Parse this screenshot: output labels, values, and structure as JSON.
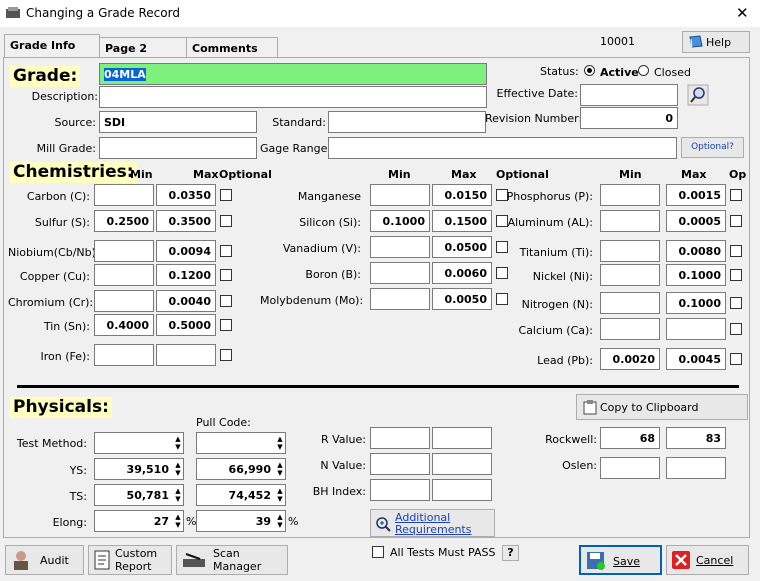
{
  "window": {
    "title": "Changing a Grade Record",
    "record_id": "10001"
  },
  "tabs": [
    {
      "label": "Grade Info"
    },
    {
      "label": "Page 2"
    },
    {
      "label": "Comments"
    }
  ],
  "help_button": "Help",
  "grade": {
    "header": "Grade:",
    "grade_value": "04MLA",
    "description_label": "Description:",
    "description_value": "",
    "source_label": "Source:",
    "source_value": "SDI",
    "standard_label": "Standard:",
    "standard_value": "",
    "mill_grade_label": "Mill Grade:",
    "mill_grade_value": "",
    "gage_range_label": "Gage Range:",
    "gage_range_value": "",
    "optional_button": "Optional?",
    "status_label": "Status:",
    "status_active": "Active",
    "status_closed": "Closed",
    "effective_date_label": "Effective Date:",
    "effective_date_value": "",
    "revision_label": "Revision Number:",
    "revision_value": "0"
  },
  "chem": {
    "header": "Chemistries:",
    "col_min": "Min",
    "col_max": "Max",
    "col_optional": "Optional",
    "col_op": "Op",
    "col1": [
      {
        "label": "Carbon (C):",
        "min": "",
        "max": "0.0350"
      },
      {
        "label": "Sulfur (S):",
        "min": "0.2500",
        "max": "0.3500"
      },
      {
        "label": "Niobium(Cb/Nb)",
        "min": "",
        "max": "0.0094"
      },
      {
        "label": "Copper (Cu):",
        "min": "",
        "max": "0.1200"
      },
      {
        "label": "Chromium (Cr):",
        "min": "",
        "max": "0.0040"
      },
      {
        "label": "Tin (Sn):",
        "min": "0.4000",
        "max": "0.5000"
      },
      {
        "label": "Iron (Fe):",
        "min": "",
        "max": ""
      }
    ],
    "col2": [
      {
        "label": "Manganese",
        "min": "",
        "max": "0.0150"
      },
      {
        "label": "Silicon (Si):",
        "min": "0.1000",
        "max": "0.1500"
      },
      {
        "label": "Vanadium (V):",
        "min": "",
        "max": "0.0500"
      },
      {
        "label": "Boron (B):",
        "min": "",
        "max": "0.0060"
      },
      {
        "label": "Molybdenum (Mo):",
        "min": "",
        "max": "0.0050"
      }
    ],
    "col3": [
      {
        "label": "Phosphorus (P):",
        "min": "",
        "max": "0.0015"
      },
      {
        "label": "Aluminum (AL):",
        "min": "",
        "max": "0.0005"
      },
      {
        "label": "Titanium (Ti):",
        "min": "",
        "max": "0.0080"
      },
      {
        "label": "Nickel (Ni):",
        "min": "",
        "max": "0.1000"
      },
      {
        "label": "Nitrogen (N):",
        "min": "",
        "max": "0.1000"
      },
      {
        "label": "Calcium (Ca):",
        "min": "",
        "max": ""
      },
      {
        "label": "Lead (Pb):",
        "min": "0.0020",
        "max": "0.0045"
      }
    ]
  },
  "phys": {
    "header": "Physicals:",
    "pull_code_label": "Pull Code:",
    "copy_button": "Copy to Clipboard",
    "test_method_label": "Test Method:",
    "ys_label": "YS:",
    "ys_min": "39,510",
    "ys_max": "66,990",
    "ts_label": "TS:",
    "ts_min": "50,781",
    "ts_max": "74,452",
    "elong_label": "Elong:",
    "elong_min": "27",
    "elong_max": "39",
    "pct": "%",
    "r_value_label": "R Value:",
    "n_value_label": "N Value:",
    "bh_index_label": "BH Index:",
    "additional_req": "Additional Requirements",
    "rockwell_label": "Rockwell:",
    "rockwell_min": "68",
    "rockwell_max": "83",
    "oslen_label": "Oslen:"
  },
  "footer": {
    "audit": "Audit",
    "custom_report": "Custom Report",
    "scan_manager": "Scan Manager",
    "all_tests": "All Tests Must PASS",
    "question": "?",
    "save": "Save",
    "cancel": "Cancel"
  }
}
